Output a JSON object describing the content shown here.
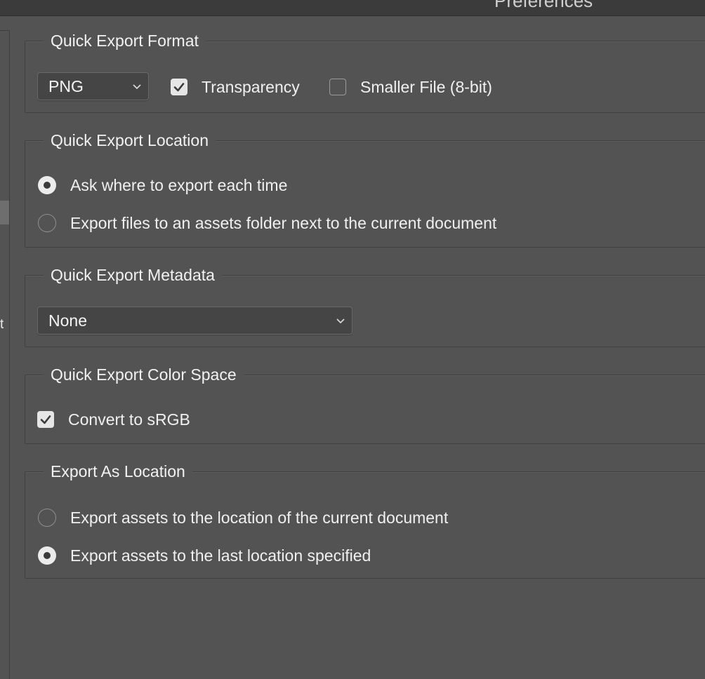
{
  "window": {
    "title": "Preferences"
  },
  "sidebar": {
    "clipped_item_text": "t"
  },
  "quick_export_format": {
    "legend": "Quick Export Format",
    "format_select": {
      "value": "PNG"
    },
    "transparency": {
      "label": "Transparency",
      "checked": true
    },
    "smaller_file": {
      "label": "Smaller File (8-bit)",
      "checked": false
    }
  },
  "quick_export_location": {
    "legend": "Quick Export Location",
    "options": [
      {
        "label": "Ask where to export each time",
        "selected": true
      },
      {
        "label": "Export files to an assets folder next to the current document",
        "selected": false
      }
    ]
  },
  "quick_export_metadata": {
    "legend": "Quick Export Metadata",
    "metadata_select": {
      "value": "None"
    }
  },
  "quick_export_color_space": {
    "legend": "Quick Export Color Space",
    "convert_srgb": {
      "label": "Convert to sRGB",
      "checked": true
    }
  },
  "export_as_location": {
    "legend": "Export As Location",
    "options": [
      {
        "label": "Export assets to the location of the current document",
        "selected": false
      },
      {
        "label": "Export assets to the last location specified",
        "selected": true
      }
    ]
  },
  "colors": {
    "panel_bg": "#535353",
    "titlebar_bg": "#3b3b3b",
    "control_bg": "#454545",
    "text": "#f0f0f0"
  }
}
